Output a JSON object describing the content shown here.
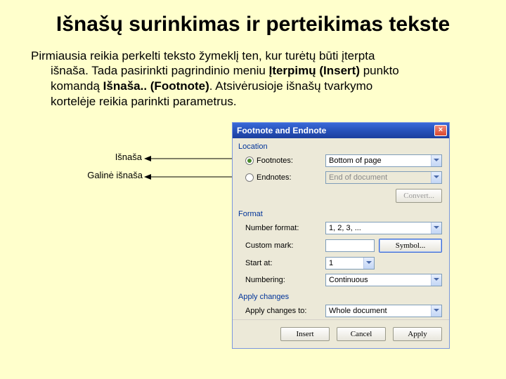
{
  "title": "Išnašų surinkimas ir perteikimas tekste",
  "paragraph_line1": "Pirmiausia reikia perkelti teksto žymeklį ten, kur turėtų būti įterpta",
  "paragraph_line2_a": "išnaša. Tada pasirinkti pagrindinio meniu ",
  "paragraph_line2_b": "Įterpimų (Insert)",
  "paragraph_line2_c": " punkto",
  "paragraph_line3_a": "komandą ",
  "paragraph_line3_b": "Išnaša.. (Footnote)",
  "paragraph_line3_c": ". Atsivėrusioje išnašų tvarkymo",
  "paragraph_line4": "kortelėje reikia parinkti parametrus.",
  "annotations": {
    "footnote": "Išnaša",
    "endnote": "Galinė išnaša"
  },
  "dialog": {
    "title": "Footnote and Endnote",
    "sections": {
      "location": "Location",
      "format": "Format",
      "apply": "Apply changes"
    },
    "location": {
      "footnotes_label": "Footnotes:",
      "footnotes_value": "Bottom of page",
      "endnotes_label": "Endnotes:",
      "endnotes_value": "End of document",
      "convert": "Convert..."
    },
    "format": {
      "number_format_label": "Number format:",
      "number_format_value": "1, 2, 3, ...",
      "custom_mark_label": "Custom mark:",
      "custom_mark_value": "",
      "symbol_btn": "Symbol...",
      "start_at_label": "Start at:",
      "start_at_value": "1",
      "numbering_label": "Numbering:",
      "numbering_value": "Continuous"
    },
    "apply_section": {
      "apply_to_label": "Apply changes to:",
      "apply_to_value": "Whole document"
    },
    "buttons": {
      "insert": "Insert",
      "cancel": "Cancel",
      "apply": "Apply"
    }
  }
}
